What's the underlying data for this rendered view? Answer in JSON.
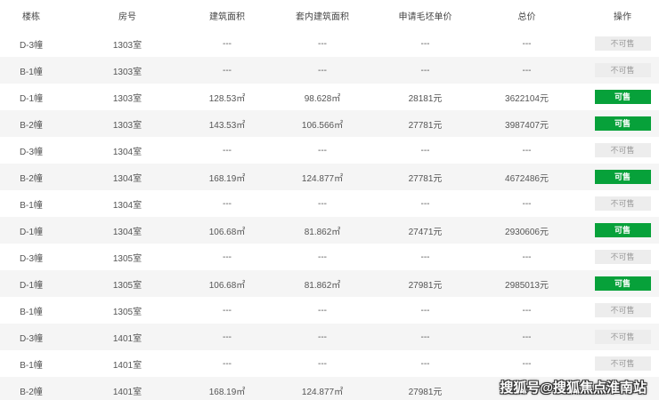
{
  "headers": [
    "楼栋",
    "房号",
    "建筑面积",
    "套内建筑面积",
    "申请毛坯单价",
    "总价",
    "操作"
  ],
  "rows": [
    {
      "building": "D-3幢",
      "room": "1303室",
      "area": "---",
      "inner_area": "---",
      "unit_price": "---",
      "total": "---",
      "action": "不可售",
      "available": false
    },
    {
      "building": "B-1幢",
      "room": "1303室",
      "area": "---",
      "inner_area": "---",
      "unit_price": "---",
      "total": "---",
      "action": "不可售",
      "available": false
    },
    {
      "building": "D-1幢",
      "room": "1303室",
      "area": "128.53㎡",
      "inner_area": "98.628㎡",
      "unit_price": "28181元",
      "total": "3622104元",
      "action": "可售",
      "available": true
    },
    {
      "building": "B-2幢",
      "room": "1303室",
      "area": "143.53㎡",
      "inner_area": "106.566㎡",
      "unit_price": "27781元",
      "total": "3987407元",
      "action": "可售",
      "available": true
    },
    {
      "building": "D-3幢",
      "room": "1304室",
      "area": "---",
      "inner_area": "---",
      "unit_price": "---",
      "total": "---",
      "action": "不可售",
      "available": false
    },
    {
      "building": "B-2幢",
      "room": "1304室",
      "area": "168.19㎡",
      "inner_area": "124.877㎡",
      "unit_price": "27781元",
      "total": "4672486元",
      "action": "可售",
      "available": true
    },
    {
      "building": "B-1幢",
      "room": "1304室",
      "area": "---",
      "inner_area": "---",
      "unit_price": "---",
      "total": "---",
      "action": "不可售",
      "available": false
    },
    {
      "building": "D-1幢",
      "room": "1304室",
      "area": "106.68㎡",
      "inner_area": "81.862㎡",
      "unit_price": "27471元",
      "total": "2930606元",
      "action": "可售",
      "available": true
    },
    {
      "building": "D-3幢",
      "room": "1305室",
      "area": "---",
      "inner_area": "---",
      "unit_price": "---",
      "total": "---",
      "action": "不可售",
      "available": false
    },
    {
      "building": "D-1幢",
      "room": "1305室",
      "area": "106.68㎡",
      "inner_area": "81.862㎡",
      "unit_price": "27981元",
      "total": "2985013元",
      "action": "可售",
      "available": true
    },
    {
      "building": "B-1幢",
      "room": "1305室",
      "area": "---",
      "inner_area": "---",
      "unit_price": "---",
      "total": "---",
      "action": "不可售",
      "available": false
    },
    {
      "building": "D-3幢",
      "room": "1401室",
      "area": "---",
      "inner_area": "---",
      "unit_price": "---",
      "total": "---",
      "action": "不可售",
      "available": false
    },
    {
      "building": "B-1幢",
      "room": "1401室",
      "area": "---",
      "inner_area": "---",
      "unit_price": "---",
      "total": "---",
      "action": "不可售",
      "available": false
    },
    {
      "building": "B-2幢",
      "room": "1401室",
      "area": "168.19㎡",
      "inner_area": "124.877㎡",
      "unit_price": "27981元",
      "total": "4",
      "action": "",
      "available": true
    }
  ],
  "watermark": "搜狐号@搜狐焦点淮南站",
  "colors": {
    "available": "#07a13a",
    "unavailable_bg": "#ededed",
    "stripe": "#f5f5f5"
  }
}
